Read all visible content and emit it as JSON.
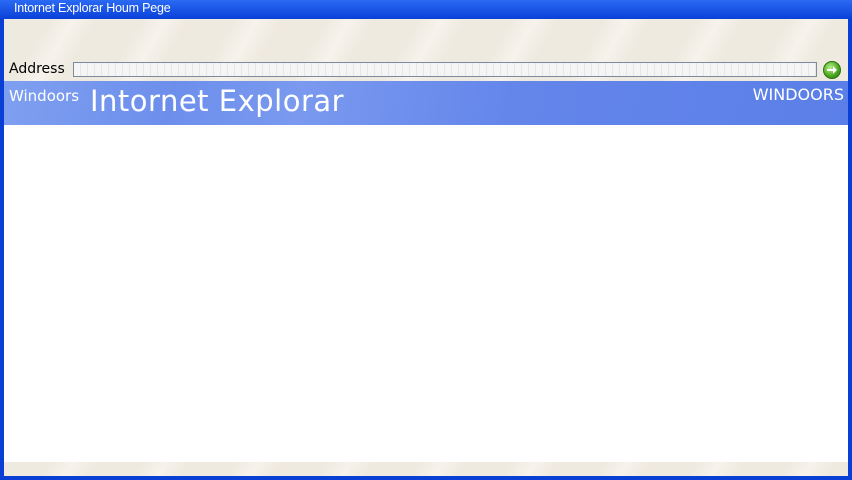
{
  "window": {
    "title": "Intornet Explorar Houm Pege"
  },
  "address_bar": {
    "label": "Address",
    "value": "",
    "go_icon": "green-arrow-go-icon"
  },
  "banner": {
    "left_text": "Windoors",
    "title": "Intornet Explorar",
    "right_text": "WINDOORS"
  },
  "colors": {
    "titlebar": "#0a40d8",
    "banner": "#6d8fec",
    "chrome": "#efeae0",
    "go_button": "#47a51d"
  }
}
